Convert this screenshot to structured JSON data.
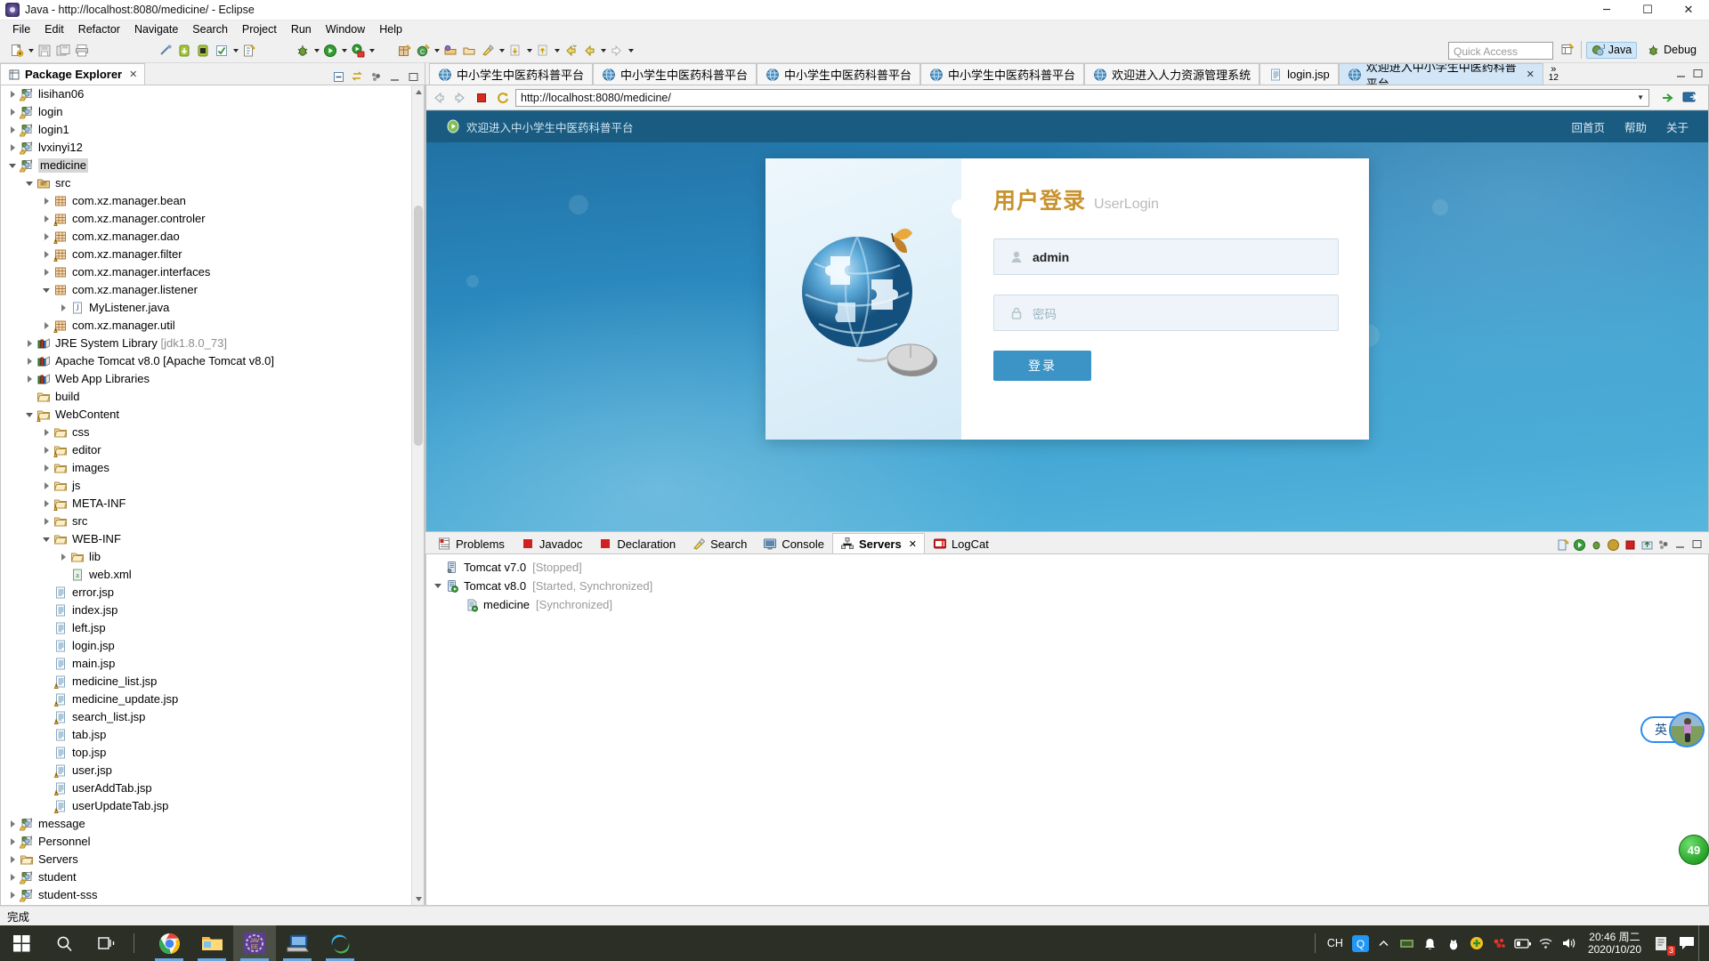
{
  "window": {
    "title": "Java - http://localhost:8080/medicine/ - Eclipse",
    "minimize": "─",
    "maximize": "☐",
    "close": "✕"
  },
  "menubar": [
    "File",
    "Edit",
    "Refactor",
    "Navigate",
    "Search",
    "Project",
    "Run",
    "Window",
    "Help"
  ],
  "toolbar": {
    "quick_access_placeholder": "Quick Access",
    "perspective_java": "Java",
    "perspective_debug": "Debug"
  },
  "package_explorer": {
    "tab_title": "Package Explorer",
    "close_glyph": "✕",
    "tree": [
      {
        "indent": 0,
        "arrow": "collapsed",
        "icon": "java-project-icon",
        "label": "lisihan06"
      },
      {
        "indent": 0,
        "arrow": "collapsed",
        "icon": "java-project-icon",
        "label": "login"
      },
      {
        "indent": 0,
        "arrow": "collapsed",
        "icon": "java-project-icon",
        "label": "login1"
      },
      {
        "indent": 0,
        "arrow": "collapsed",
        "icon": "java-project-icon",
        "label": "lvxinyi12"
      },
      {
        "indent": 0,
        "arrow": "expanded",
        "icon": "java-project-icon",
        "label": "medicine",
        "selected": true
      },
      {
        "indent": 1,
        "arrow": "expanded",
        "icon": "source-folder-icon",
        "label": "src"
      },
      {
        "indent": 2,
        "arrow": "collapsed",
        "icon": "package-icon",
        "label": "com.xz.manager.bean"
      },
      {
        "indent": 2,
        "arrow": "collapsed",
        "icon": "package-warn-icon",
        "label": "com.xz.manager.controler"
      },
      {
        "indent": 2,
        "arrow": "collapsed",
        "icon": "package-warn-icon",
        "label": "com.xz.manager.dao"
      },
      {
        "indent": 2,
        "arrow": "collapsed",
        "icon": "package-warn-icon",
        "label": "com.xz.manager.filter"
      },
      {
        "indent": 2,
        "arrow": "collapsed",
        "icon": "package-icon",
        "label": "com.xz.manager.interfaces"
      },
      {
        "indent": 2,
        "arrow": "expanded",
        "icon": "package-icon",
        "label": "com.xz.manager.listener"
      },
      {
        "indent": 3,
        "arrow": "collapsed",
        "icon": "java-file-icon",
        "label": "MyListener.java"
      },
      {
        "indent": 2,
        "arrow": "collapsed",
        "icon": "package-warn-icon",
        "label": "com.xz.manager.util"
      },
      {
        "indent": 1,
        "arrow": "collapsed",
        "icon": "library-icon",
        "label": "JRE System Library",
        "dim": " [jdk1.8.0_73]"
      },
      {
        "indent": 1,
        "arrow": "collapsed",
        "icon": "library-icon",
        "label": "Apache Tomcat v8.0 [Apache Tomcat v8.0]"
      },
      {
        "indent": 1,
        "arrow": "collapsed",
        "icon": "library-icon",
        "label": "Web App Libraries"
      },
      {
        "indent": 1,
        "arrow": "none",
        "icon": "folder-icon",
        "label": "build"
      },
      {
        "indent": 1,
        "arrow": "expanded",
        "icon": "folder-warn-icon",
        "label": "WebContent"
      },
      {
        "indent": 2,
        "arrow": "collapsed",
        "icon": "folder-icon",
        "label": "css"
      },
      {
        "indent": 2,
        "arrow": "collapsed",
        "icon": "folder-warn-icon",
        "label": "editor"
      },
      {
        "indent": 2,
        "arrow": "collapsed",
        "icon": "folder-icon",
        "label": "images"
      },
      {
        "indent": 2,
        "arrow": "collapsed",
        "icon": "folder-icon",
        "label": "js"
      },
      {
        "indent": 2,
        "arrow": "collapsed",
        "icon": "folder-warn-icon",
        "label": "META-INF"
      },
      {
        "indent": 2,
        "arrow": "collapsed",
        "icon": "folder-icon",
        "label": "src"
      },
      {
        "indent": 2,
        "arrow": "expanded",
        "icon": "folder-icon",
        "label": "WEB-INF"
      },
      {
        "indent": 3,
        "arrow": "collapsed",
        "icon": "folder-icon",
        "label": "lib"
      },
      {
        "indent": 3,
        "arrow": "none",
        "icon": "xml-file-icon",
        "label": "web.xml"
      },
      {
        "indent": 2,
        "arrow": "none",
        "icon": "jsp-file-icon",
        "label": "error.jsp"
      },
      {
        "indent": 2,
        "arrow": "none",
        "icon": "jsp-file-icon",
        "label": "index.jsp"
      },
      {
        "indent": 2,
        "arrow": "none",
        "icon": "jsp-file-icon",
        "label": "left.jsp"
      },
      {
        "indent": 2,
        "arrow": "none",
        "icon": "jsp-file-icon",
        "label": "login.jsp"
      },
      {
        "indent": 2,
        "arrow": "none",
        "icon": "jsp-file-icon",
        "label": "main.jsp"
      },
      {
        "indent": 2,
        "arrow": "none",
        "icon": "jsp-warn-file-icon",
        "label": "medicine_list.jsp"
      },
      {
        "indent": 2,
        "arrow": "none",
        "icon": "jsp-warn-file-icon",
        "label": "medicine_update.jsp"
      },
      {
        "indent": 2,
        "arrow": "none",
        "icon": "jsp-warn-file-icon",
        "label": "search_list.jsp"
      },
      {
        "indent": 2,
        "arrow": "none",
        "icon": "jsp-file-icon",
        "label": "tab.jsp"
      },
      {
        "indent": 2,
        "arrow": "none",
        "icon": "jsp-file-icon",
        "label": "top.jsp"
      },
      {
        "indent": 2,
        "arrow": "none",
        "icon": "jsp-warn-file-icon",
        "label": "user.jsp"
      },
      {
        "indent": 2,
        "arrow": "none",
        "icon": "jsp-warn-file-icon",
        "label": "userAddTab.jsp"
      },
      {
        "indent": 2,
        "arrow": "none",
        "icon": "jsp-warn-file-icon",
        "label": "userUpdateTab.jsp"
      },
      {
        "indent": 0,
        "arrow": "collapsed",
        "icon": "java-project-icon",
        "label": "message"
      },
      {
        "indent": 0,
        "arrow": "collapsed",
        "icon": "java-project-icon",
        "label": "Personnel"
      },
      {
        "indent": 0,
        "arrow": "collapsed",
        "icon": "folder-icon",
        "label": "Servers"
      },
      {
        "indent": 0,
        "arrow": "collapsed",
        "icon": "java-project-icon",
        "label": "student"
      },
      {
        "indent": 0,
        "arrow": "collapsed",
        "icon": "java-project-icon",
        "label": "student-sss"
      }
    ]
  },
  "editor": {
    "tabs": [
      {
        "label": "中小学生中医药科普平台",
        "icon": "web-browser-icon",
        "active": false,
        "closable": false
      },
      {
        "label": "中小学生中医药科普平台",
        "icon": "web-browser-icon",
        "active": false,
        "closable": false
      },
      {
        "label": "中小学生中医药科普平台",
        "icon": "web-browser-icon",
        "active": false,
        "closable": false
      },
      {
        "label": "中小学生中医药科普平台",
        "icon": "web-browser-icon",
        "active": false,
        "closable": false
      },
      {
        "label": "欢迎进入人力资源管理系统",
        "icon": "web-browser-icon",
        "active": false,
        "closable": false
      },
      {
        "label": "login.jsp",
        "icon": "jsp-file-icon",
        "active": false,
        "closable": false
      },
      {
        "label": "欢迎进入中小学生中医药科普平台",
        "icon": "web-browser-icon",
        "active": true,
        "closable": true
      }
    ],
    "close_glyph": "✕",
    "more_tabs_glyph": "»",
    "hidden_tab_count": "12"
  },
  "browser": {
    "url": "http://localhost:8080/medicine/",
    "back_icon": "back-arrow-icon",
    "forward_icon": "forward-arrow-icon",
    "stop_icon": "stop-icon",
    "refresh_icon": "refresh-icon"
  },
  "webpage": {
    "header_brand": "欢迎进入中小学生中医药科普平台",
    "nav": [
      "回首页",
      "帮助",
      "关于"
    ],
    "login": {
      "title_cn": "用户登录",
      "title_en": "UserLogin",
      "username_value": "admin",
      "password_placeholder": "密码",
      "submit_label": "登录"
    }
  },
  "bottom_views": {
    "tabs": [
      {
        "label": "Problems",
        "icon": "problems-icon",
        "active": false
      },
      {
        "label": "Javadoc",
        "icon": "javadoc-icon",
        "active": false
      },
      {
        "label": "Declaration",
        "icon": "declaration-icon",
        "active": false
      },
      {
        "label": "Search",
        "icon": "search-icon",
        "active": false
      },
      {
        "label": "Console",
        "icon": "console-icon",
        "active": false
      },
      {
        "label": "Servers",
        "icon": "servers-icon",
        "active": true
      },
      {
        "label": "LogCat",
        "icon": "logcat-icon",
        "active": false
      }
    ],
    "close_glyph": "✕",
    "servers": [
      {
        "indent": 0,
        "arrow": "none",
        "icon": "server-stopped-icon",
        "name": "Tomcat v7.0",
        "state": "[Stopped]"
      },
      {
        "indent": 0,
        "arrow": "expanded",
        "icon": "server-started-icon",
        "name": "Tomcat v8.0",
        "state": "[Started, Synchronized]"
      },
      {
        "indent": 1,
        "arrow": "none",
        "icon": "module-icon",
        "name": "medicine",
        "state": "[Synchronized]"
      }
    ]
  },
  "statusbar": {
    "text": "完成"
  },
  "desktop_widgets": {
    "ime_label": "英",
    "avatar_name": "user-avatar",
    "green_badge": "49"
  },
  "taskbar": {
    "items": [
      {
        "name": "start-button",
        "running": false,
        "active": false
      },
      {
        "name": "search-button",
        "running": false,
        "active": false
      },
      {
        "name": "task-view-button",
        "running": false,
        "active": false
      },
      {
        "name": "chrome-taskbar",
        "running": true,
        "active": false
      },
      {
        "name": "explorer-taskbar",
        "running": true,
        "active": false
      },
      {
        "name": "eclipse-taskbar",
        "running": true,
        "active": true
      },
      {
        "name": "rdp-taskbar",
        "running": true,
        "active": false
      },
      {
        "name": "navicat-taskbar",
        "running": true,
        "active": false
      }
    ],
    "ime_lang": "CH",
    "time": "20:46 周二",
    "date": "2020/10/20",
    "notification_count": "3"
  }
}
